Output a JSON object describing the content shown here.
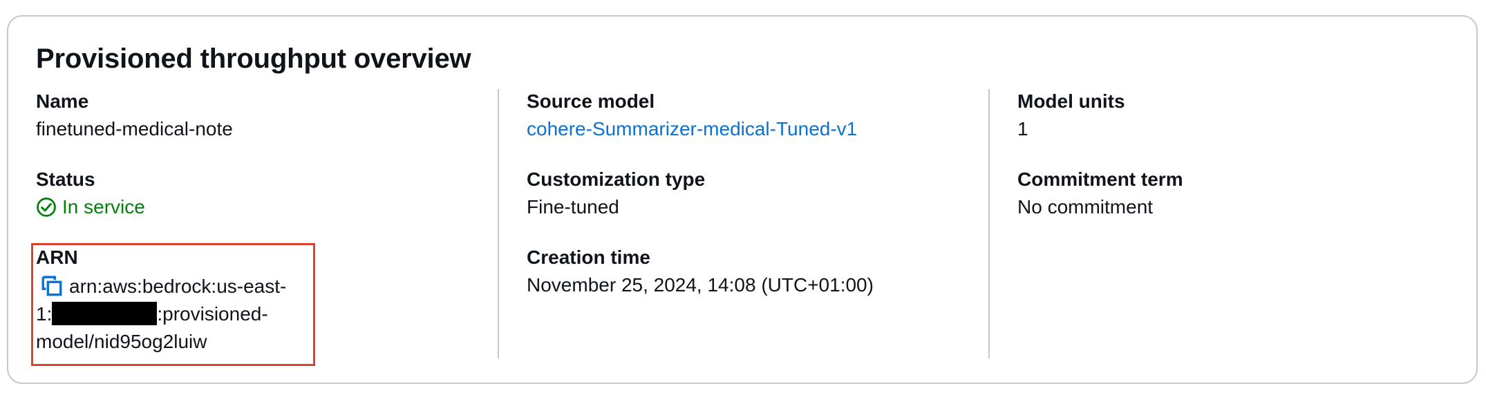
{
  "panel": {
    "title": "Provisioned throughput overview"
  },
  "fields": {
    "name": {
      "label": "Name",
      "value": "finetuned-medical-note"
    },
    "status": {
      "label": "Status",
      "value": "In service",
      "icon": "check-circle-icon",
      "color": "#037f0c"
    },
    "arn": {
      "label": "ARN",
      "line1": "arn:aws:bedrock:us-east-",
      "line2_prefix": "1:",
      "line2_suffix": ":provisioned-",
      "line3": "model/nid95og2luiw",
      "copy_icon": "copy-icon",
      "highlight_color": "#e0402e"
    },
    "source_model": {
      "label": "Source model",
      "value": "cohere-Summarizer-medical-Tuned-v1",
      "color": "#0972d3"
    },
    "customization_type": {
      "label": "Customization type",
      "value": "Fine-tuned"
    },
    "creation_time": {
      "label": "Creation time",
      "value": "November 25, 2024, 14:08 (UTC+01:00)"
    },
    "model_units": {
      "label": "Model units",
      "value": "1"
    },
    "commitment_term": {
      "label": "Commitment term",
      "value": "No commitment"
    }
  }
}
